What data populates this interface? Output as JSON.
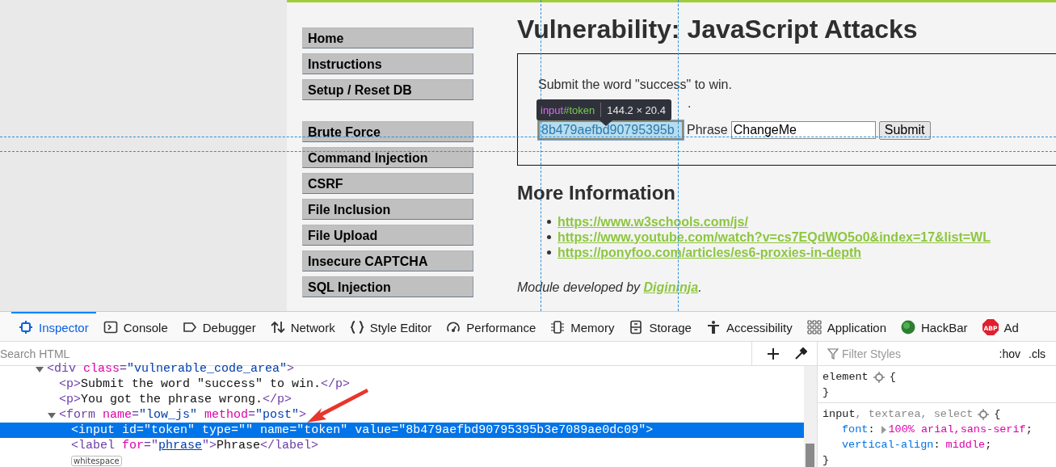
{
  "page": {
    "menu_groups": [
      [
        "Home",
        "Instructions",
        "Setup / Reset DB"
      ],
      [
        "Brute Force",
        "Command Injection",
        "CSRF",
        "File Inclusion",
        "File Upload",
        "Insecure CAPTCHA",
        "SQL Injection"
      ]
    ],
    "title": "Vulnerability: JavaScript Attacks",
    "challenge": {
      "instruction": "Submit the word \"success\" to win.",
      "hidden_tail": ".",
      "token_field": {
        "value": "8b479aefbd90795395b",
        "highlighted": true
      },
      "phrase_label": "Phrase",
      "phrase_field": {
        "value": "ChangeMe"
      },
      "submit": "Submit"
    },
    "more_heading": "More Information",
    "links": [
      "https://www.w3schools.com/js/",
      "https://www.youtube.com/watch?v=cs7EQdWO5o0&index=17&list=WL",
      "https://ponyfoo.com/articles/es6-proxies-in-depth"
    ],
    "credit": {
      "before": "Module developed by ",
      "link": "Digininja",
      "after": "."
    }
  },
  "inspector_tooltip": {
    "tag": "input",
    "id": "#token",
    "size": "144.2 × 20.4"
  },
  "devtools": {
    "tabs": [
      {
        "label": "Inspector",
        "selected": true
      },
      {
        "label": "Console",
        "selected": false
      },
      {
        "label": "Debugger",
        "selected": false
      },
      {
        "label": "Network",
        "selected": false
      },
      {
        "label": "Style Editor",
        "selected": false
      },
      {
        "label": "Performance",
        "selected": false
      },
      {
        "label": "Memory",
        "selected": false
      },
      {
        "label": "Storage",
        "selected": false
      },
      {
        "label": "Accessibility",
        "selected": false
      },
      {
        "label": "Application",
        "selected": false
      },
      {
        "label": "HackBar",
        "selected": false
      },
      {
        "label": "Ad",
        "badge": "ABP",
        "selected": false
      }
    ],
    "search": {
      "placeholder": "Search HTML"
    },
    "markup": [
      {
        "expanded": true,
        "selected": false,
        "parts": [
          {
            "kind": "tag",
            "text": "<div"
          },
          {
            "kind": "attr",
            "text": " class"
          },
          {
            "kind": "tag",
            "text": "="
          },
          {
            "kind": "value",
            "text": "\"vulnerable_code_area\""
          },
          {
            "kind": "tag",
            "text": ">"
          }
        ],
        "children": [
          {
            "selected": false,
            "parts": [
              {
                "kind": "tag",
                "text": "<p>"
              },
              {
                "kind": "text",
                "text": "Submit the word \"success\" to win."
              },
              {
                "kind": "tag",
                "text": "</p>"
              }
            ]
          },
          {
            "selected": false,
            "parts": [
              {
                "kind": "tag",
                "text": "<p>"
              },
              {
                "kind": "text",
                "text": "You got the phrase wrong."
              },
              {
                "kind": "tag",
                "text": "</p>"
              }
            ]
          },
          {
            "expanded": true,
            "selected": false,
            "parts": [
              {
                "kind": "tag",
                "text": "<form"
              },
              {
                "kind": "attr",
                "text": " name"
              },
              {
                "kind": "tag",
                "text": "="
              },
              {
                "kind": "value",
                "text": "\"low_js\""
              },
              {
                "kind": "attr",
                "text": " method"
              },
              {
                "kind": "tag",
                "text": "="
              },
              {
                "kind": "value",
                "text": "\"post\""
              },
              {
                "kind": "tag",
                "text": ">"
              }
            ],
            "children": [
              {
                "selected": true,
                "parts": [
                  {
                    "kind": "tag",
                    "text": "<input"
                  },
                  {
                    "kind": "attr",
                    "text": " id"
                  },
                  {
                    "kind": "tag",
                    "text": "="
                  },
                  {
                    "kind": "value",
                    "text": "\"token\""
                  },
                  {
                    "kind": "attr",
                    "text": " type"
                  },
                  {
                    "kind": "tag",
                    "text": "="
                  },
                  {
                    "kind": "value",
                    "text": "\"\""
                  },
                  {
                    "kind": "attr",
                    "text": " name"
                  },
                  {
                    "kind": "tag",
                    "text": "="
                  },
                  {
                    "kind": "value",
                    "text": "\"token\""
                  },
                  {
                    "kind": "attr",
                    "text": " value"
                  },
                  {
                    "kind": "tag",
                    "text": "="
                  },
                  {
                    "kind": "value",
                    "text": "\"8b479aefbd90795395b3e7089ae0dc09\""
                  },
                  {
                    "kind": "tag",
                    "text": ">"
                  }
                ]
              },
              {
                "selected": false,
                "parts": [
                  {
                    "kind": "tag",
                    "text": "<label"
                  },
                  {
                    "kind": "attr",
                    "text": " for"
                  },
                  {
                    "kind": "tag",
                    "text": "=\""
                  },
                  {
                    "kind": "link",
                    "text": "phrase"
                  },
                  {
                    "kind": "tag",
                    "text": "\">"
                  },
                  {
                    "kind": "text",
                    "text": "Phrase"
                  },
                  {
                    "kind": "tag",
                    "text": "</label>"
                  }
                ]
              },
              {
                "selected": false,
                "parts": [
                  {
                    "kind": "badge",
                    "text": "whitespace"
                  }
                ]
              }
            ]
          }
        ]
      }
    ],
    "rules_filter": {
      "placeholder": "Filter Styles"
    },
    "rules_toggles": [
      ":hov",
      ".cls"
    ],
    "rules": [
      {
        "selector": [
          {
            "text": "element",
            "matched": true
          }
        ],
        "open": "{",
        "close": "}"
      },
      {
        "selector": [
          {
            "text": "input",
            "matched": true
          },
          {
            "text": ", textarea, select",
            "matched": false
          }
        ],
        "open": "{",
        "close": "}",
        "declarations": [
          {
            "property": "font",
            "sep": ":",
            "value": "100% arial,sans-serif",
            "end": ";",
            "expandable": true
          },
          {
            "property": "vertical-align",
            "sep": ":",
            "value": "middle",
            "end": ";",
            "expandable": false
          }
        ]
      }
    ]
  }
}
